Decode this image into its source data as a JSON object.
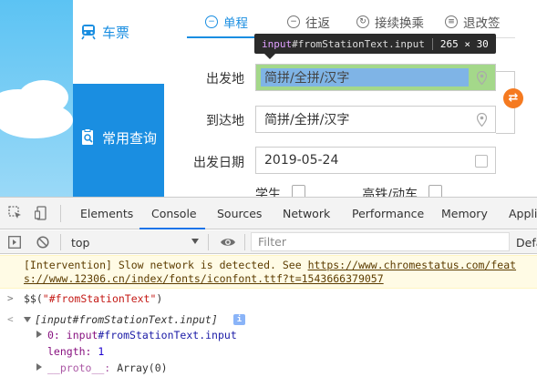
{
  "nav": {
    "ticket_label": "车票",
    "query_label": "常用查询"
  },
  "tabs": {
    "single": "单程",
    "round_trip": "往返",
    "transfer": "接续换乘",
    "refund_change": "退改签"
  },
  "tooltip": {
    "tag": "input",
    "selector": "#fromStationText.input",
    "size": "265 × 30"
  },
  "form": {
    "from_label": "出发地",
    "from_placeholder": "简拼/全拼/汉字",
    "to_label": "到达地",
    "to_placeholder": "简拼/全拼/汉字",
    "date_label": "出发日期",
    "date_value": "2019-05-24",
    "student_label": "学生",
    "highspeed_label": "高铁/动车"
  },
  "devtools": {
    "tabs": [
      "Elements",
      "Console",
      "Sources",
      "Network",
      "Performance",
      "Memory",
      "Appli"
    ],
    "active_tab": "Console",
    "context": "top",
    "filter_placeholder": "Filter",
    "levels": "Defa",
    "warning_text_1": "[Intervention] Slow network is detected. See ",
    "warning_link_1": "https://www.chromestatus.com/feat",
    "warning_link_2": "s://www.12306.cn/index/fonts/iconfont.ttf?t=1543666379057",
    "command_prefix": "$$(",
    "command_arg": "\"#fromStationText\"",
    "command_suffix": ")",
    "result_summary": "[input#fromStationText.input]",
    "result_item_index": "0:",
    "result_item_node": "input",
    "result_item_selector": "#fromStationText.input",
    "length_key": "length:",
    "length_value": "1",
    "proto_key": "__proto__:",
    "proto_value": "Array(0)"
  },
  "colors": {
    "accent": "#1a8ee1",
    "swap": "#f57a20",
    "inspect_padding": "#a4d88a",
    "inspect_content": "#7fb4e6"
  }
}
